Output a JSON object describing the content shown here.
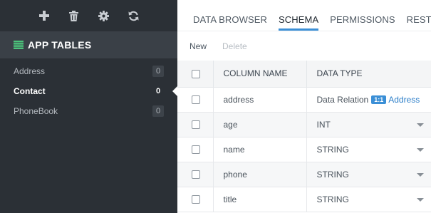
{
  "sidebar": {
    "toolbar": [
      {
        "name": "add-table-button",
        "icon": "plus-icon"
      },
      {
        "name": "delete-table-button",
        "icon": "trash-icon"
      },
      {
        "name": "settings-button",
        "icon": "gear-icon"
      },
      {
        "name": "refresh-button",
        "icon": "refresh-icon"
      }
    ],
    "header": "APP TABLES",
    "tables": [
      {
        "label": "Address",
        "count": "0",
        "active": false
      },
      {
        "label": "Contact",
        "count": "0",
        "active": true
      },
      {
        "label": "PhoneBook",
        "count": "0",
        "active": false
      }
    ]
  },
  "main": {
    "tabs": [
      {
        "label": "DATA BROWSER",
        "active": false
      },
      {
        "label": "SCHEMA",
        "active": true
      },
      {
        "label": "PERMISSIONS",
        "active": false
      },
      {
        "label": "REST CONSOLE",
        "active": false
      }
    ],
    "actions": {
      "new_label": "New",
      "delete_label": "Delete"
    },
    "columns_header": {
      "name": "COLUMN NAME",
      "type": "DATA TYPE"
    },
    "rows": [
      {
        "name": "address",
        "type": "Data Relation",
        "relation_badge": "1:1",
        "relation_target": "Address"
      },
      {
        "name": "age",
        "type": "INT"
      },
      {
        "name": "name",
        "type": "STRING"
      },
      {
        "name": "phone",
        "type": "STRING"
      },
      {
        "name": "title",
        "type": "STRING"
      }
    ]
  },
  "colors": {
    "accent": "#3b8fd6",
    "sidebar_bg": "#2b3036",
    "sidebar_header_bg": "#3a4047"
  }
}
